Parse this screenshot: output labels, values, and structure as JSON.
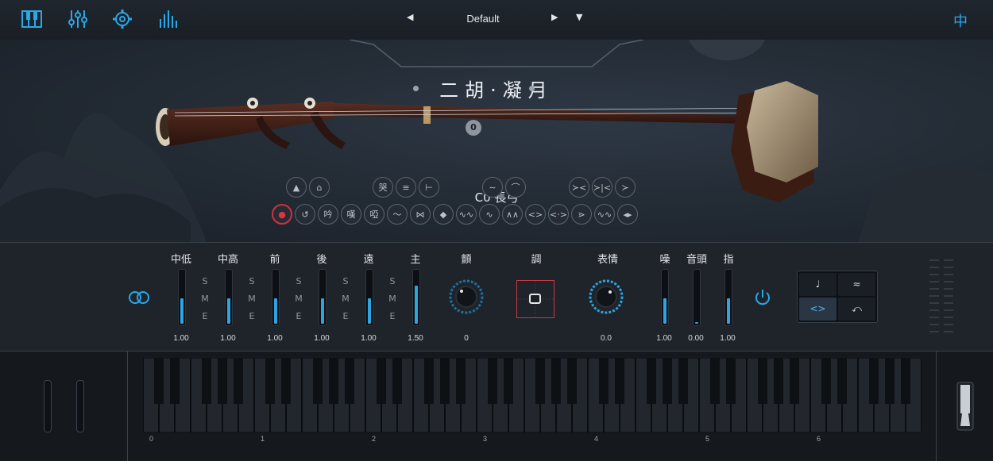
{
  "toolbar": {
    "icons": [
      "piano-icon",
      "mixer-sliders-icon",
      "gear-icon",
      "eq-bars-icon"
    ],
    "preset_name": "Default",
    "prev_glyph": "◀",
    "next_glyph": "▶",
    "menu_glyph": "▼",
    "language": "中"
  },
  "instrument": {
    "title": "二胡·凝月",
    "position_value": "0",
    "articulation": "C0 長弓"
  },
  "articulation_rows": {
    "row1": [
      [
        "▲",
        "⌂"
      ],
      [
        "哭",
        "≡",
        "⊢"
      ],
      [
        "∼",
        "⌒"
      ],
      [
        "≻<",
        "≻|<",
        "≻"
      ]
    ],
    "row2": [
      "●",
      "↺",
      "吟",
      "嘆",
      "啞",
      "〜",
      "⋈",
      "◆",
      "∿∿",
      "∿",
      "∧∧",
      "<>",
      "<·>",
      "⋗",
      "∿∿",
      "◂▸"
    ]
  },
  "mixer": {
    "channels": [
      {
        "label": "中低",
        "value": "1.00",
        "level": 0.5
      },
      {
        "label": "中高",
        "value": "1.00",
        "level": 0.5
      },
      {
        "label": "前",
        "value": "1.00",
        "level": 0.5
      },
      {
        "label": "後",
        "value": "1.00",
        "level": 0.5
      },
      {
        "label": "遠",
        "value": "1.00",
        "level": 0.5
      },
      {
        "label": "主",
        "value": "1.50",
        "level": 0.75
      }
    ],
    "sme": [
      "S",
      "M",
      "E"
    ],
    "vibrato": {
      "label": "顫",
      "value": "0"
    },
    "tune": {
      "label": "調"
    },
    "expression": {
      "label": "表情",
      "value": "0.0"
    },
    "noise": [
      {
        "label": "噪",
        "value": "1.00",
        "level": 0.5
      },
      {
        "label": "音頭",
        "value": "0.00",
        "level": 0.02
      },
      {
        "label": "指",
        "value": "1.00",
        "level": 0.5
      }
    ],
    "modes": [
      "♩",
      "≈",
      "<>",
      "⤺"
    ]
  },
  "keyboard": {
    "octave_labels": [
      "0",
      "1",
      "2",
      "3",
      "4",
      "5",
      "6"
    ]
  },
  "colors": {
    "accent": "#2ea4e0",
    "record": "#d2313b"
  }
}
